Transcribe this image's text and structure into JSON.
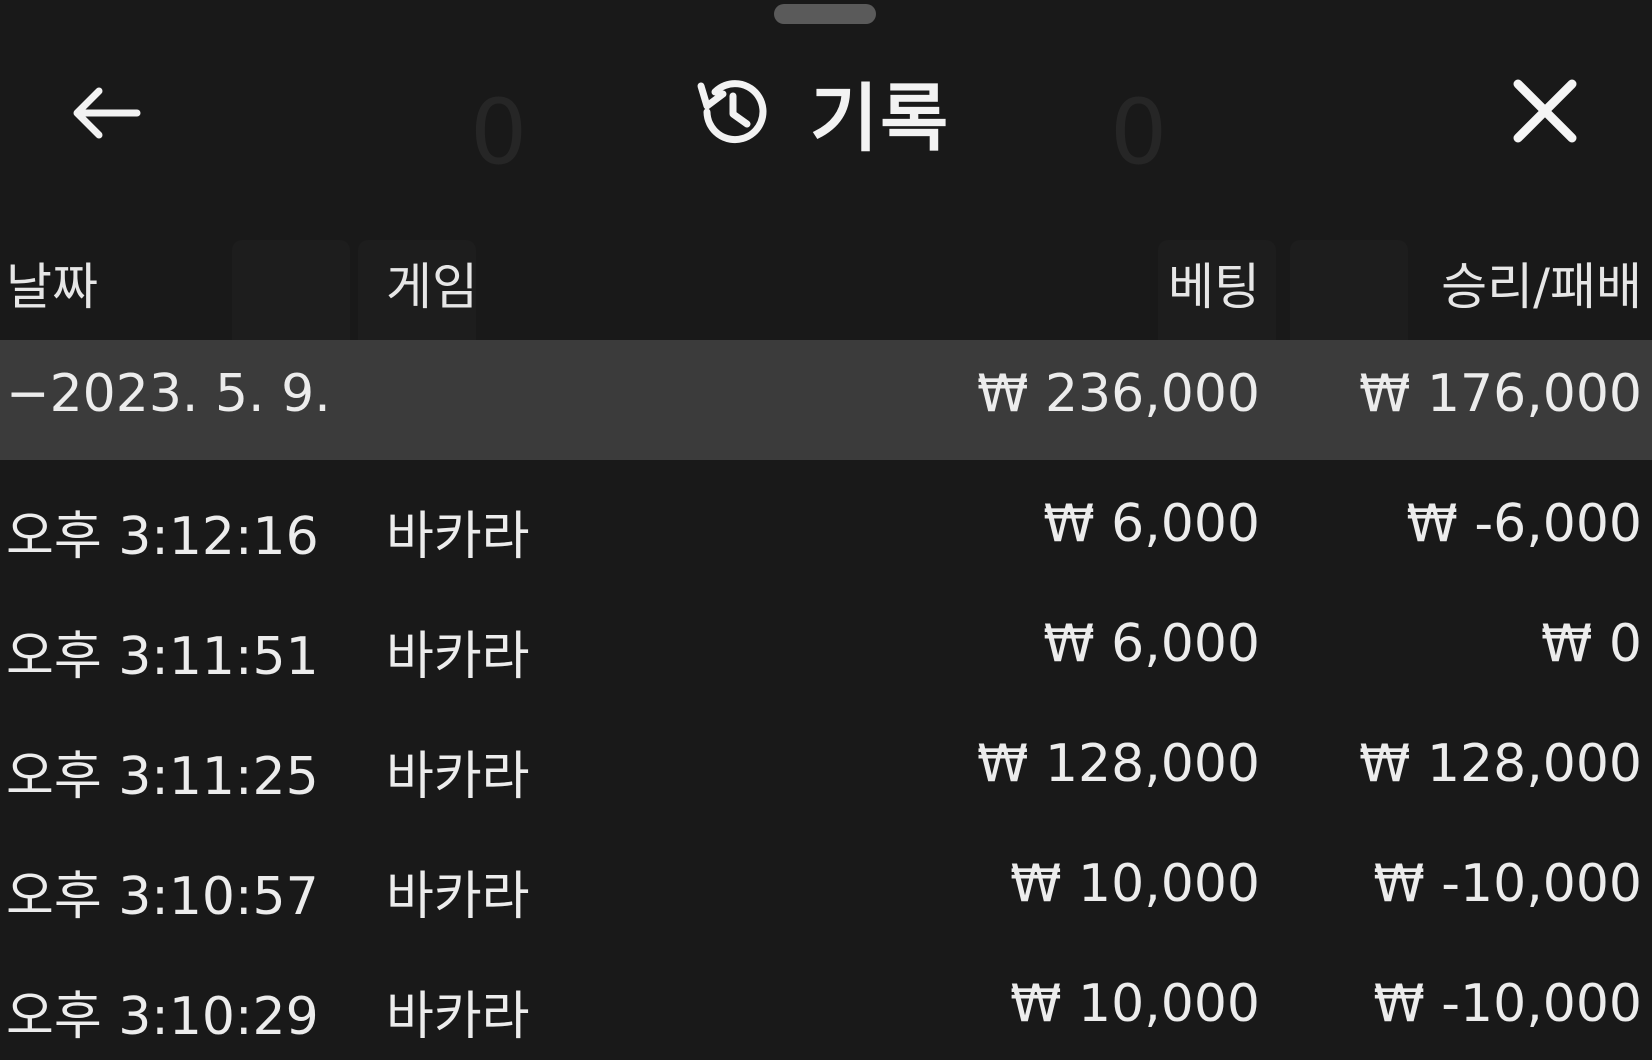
{
  "header": {
    "title": "기록",
    "back_icon": "arrow-left-icon",
    "history_icon": "history-icon",
    "close_icon": "close-icon"
  },
  "table": {
    "columns": {
      "date": "날짜",
      "game": "게임",
      "bet": "베팅",
      "result": "승리/패배"
    },
    "summary": {
      "date": "−2023. 5. 9.",
      "bet": "₩ 236,000",
      "result": "₩ 176,000"
    },
    "rows": [
      {
        "time": "오후 3:12:16",
        "game": "바카라",
        "bet": "₩ 6,000",
        "result": "₩ -6,000"
      },
      {
        "time": "오후 3:11:51",
        "game": "바카라",
        "bet": "₩ 6,000",
        "result": "₩ 0"
      },
      {
        "time": "오후 3:11:25",
        "game": "바카라",
        "bet": "₩ 128,000",
        "result": "₩ 128,000"
      },
      {
        "time": "오후 3:10:57",
        "game": "바카라",
        "bet": "₩ 10,000",
        "result": "₩ -10,000"
      },
      {
        "time": "오후 3:10:29",
        "game": "바카라",
        "bet": "₩ 10,000",
        "result": "₩ -10,000"
      }
    ]
  }
}
